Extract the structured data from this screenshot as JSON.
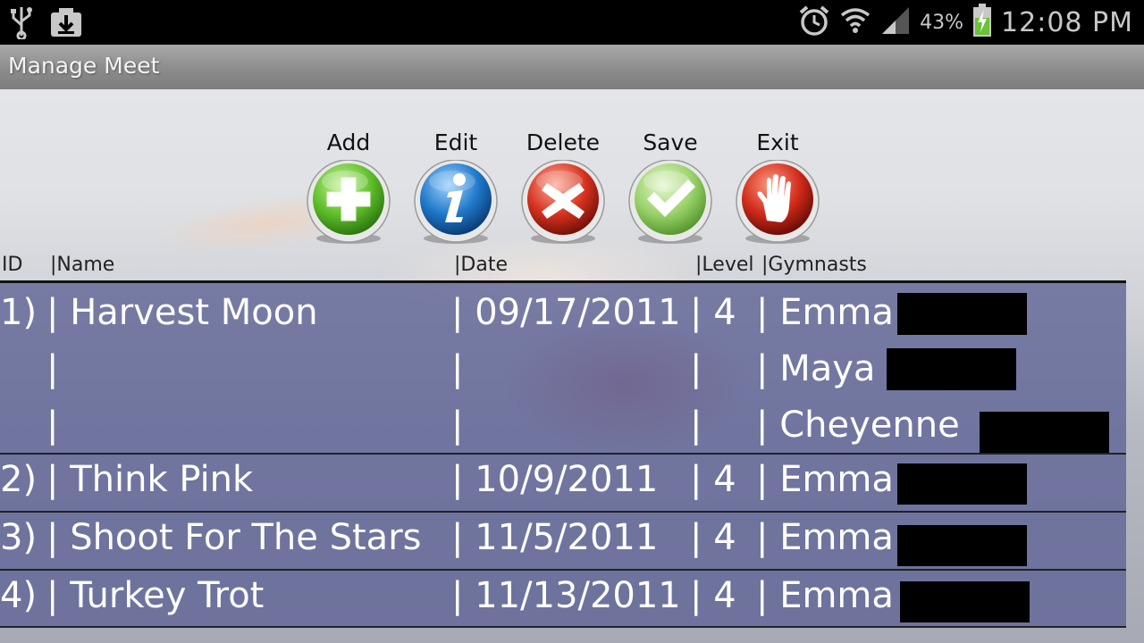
{
  "status_bar": {
    "left_icons": [
      "usb-icon",
      "download-icon"
    ],
    "right_icons": [
      "alarm-icon",
      "wifi-icon",
      "signal-icon",
      "battery-charging-icon"
    ],
    "battery_percent": "43%",
    "time": "12:08 PM"
  },
  "app_title": "Manage Meet",
  "toolbar": {
    "add_label": "Add",
    "edit_label": "Edit",
    "delete_label": "Delete",
    "save_label": "Save",
    "exit_label": "Exit"
  },
  "table": {
    "headers": [
      "ID",
      "|Name",
      "|Date",
      "|Level",
      "|Gymnasts"
    ],
    "rows": [
      {
        "lines": [
          {
            "id": "1)",
            "name": "| Harvest Moon",
            "date": "| 09/17/2011",
            "level": "| 4",
            "gymnast": "| Emma"
          },
          {
            "id": "",
            "name": "|",
            "date": "|",
            "level": "|",
            "gymnast": "| Maya"
          },
          {
            "id": "",
            "name": "|",
            "date": "|",
            "level": "|",
            "gymnast": "| Cheyenne"
          }
        ]
      },
      {
        "lines": [
          {
            "id": "2)",
            "name": "| Think Pink",
            "date": "| 10/9/2011",
            "level": "| 4",
            "gymnast": "| Emma"
          }
        ]
      },
      {
        "lines": [
          {
            "id": "3)",
            "name": "| Shoot For The Stars",
            "date": "| 11/5/2011",
            "level": "| 4",
            "gymnast": "| Emma"
          }
        ]
      },
      {
        "lines": [
          {
            "id": "4)",
            "name": "| Turkey Trot",
            "date": "| 11/13/2011",
            "level": "| 4",
            "gymnast": "| Emma"
          }
        ]
      }
    ]
  },
  "colors": {
    "add": "#5fbf2a",
    "edit": "#1f78c8",
    "delete": "#d6321f",
    "save": "#9ad26a",
    "exit": "#d02a1a",
    "table_bg": "#5f6496"
  }
}
